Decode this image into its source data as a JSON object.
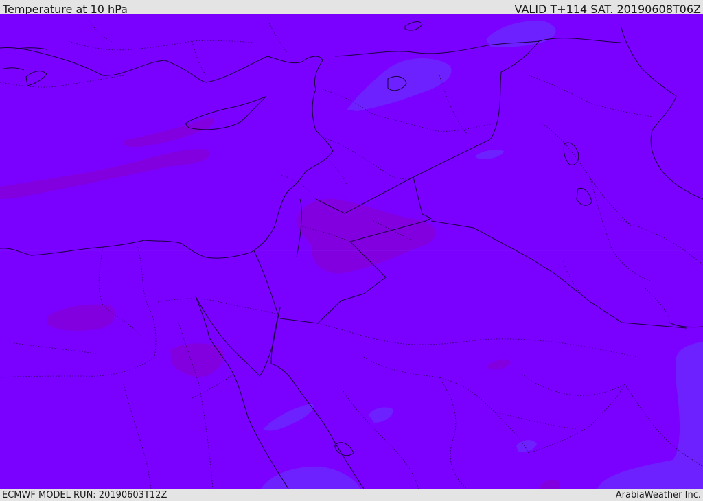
{
  "header": {
    "title": "Temperature at 10 hPa",
    "valid_time": "VALID T+114 SAT. 20190608T06Z"
  },
  "footer": {
    "model_run": "ECMWF MODEL RUN: 20190603T12Z",
    "brand": "ArabiaWeather Inc."
  },
  "map": {
    "field": "temperature",
    "level": "10 hPa",
    "colors": {
      "base": "#7a00ff",
      "warm_patch": "#8a00d6",
      "cool_patch": "#6a2cff",
      "coastline": "#1c0040",
      "border": "#1c0040"
    }
  }
}
